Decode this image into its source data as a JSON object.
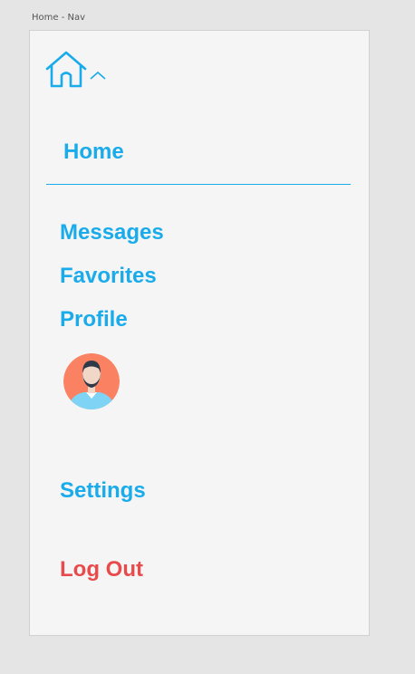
{
  "artboard": {
    "label": "Home - Nav"
  },
  "header": {
    "icon": "home-icon",
    "toggle_icon": "chevron-up-icon"
  },
  "nav": {
    "title": "Home",
    "items": [
      {
        "label": "Messages"
      },
      {
        "label": "Favorites"
      },
      {
        "label": "Profile"
      }
    ],
    "avatar_icon": "avatar",
    "settings_label": "Settings",
    "logout_label": "Log Out"
  },
  "colors": {
    "accent": "#1aabea",
    "danger": "#e84b4b",
    "avatar_bg": "#fa8263",
    "avatar_shirt": "#7fd3f5",
    "hair": "#2e3a47"
  }
}
